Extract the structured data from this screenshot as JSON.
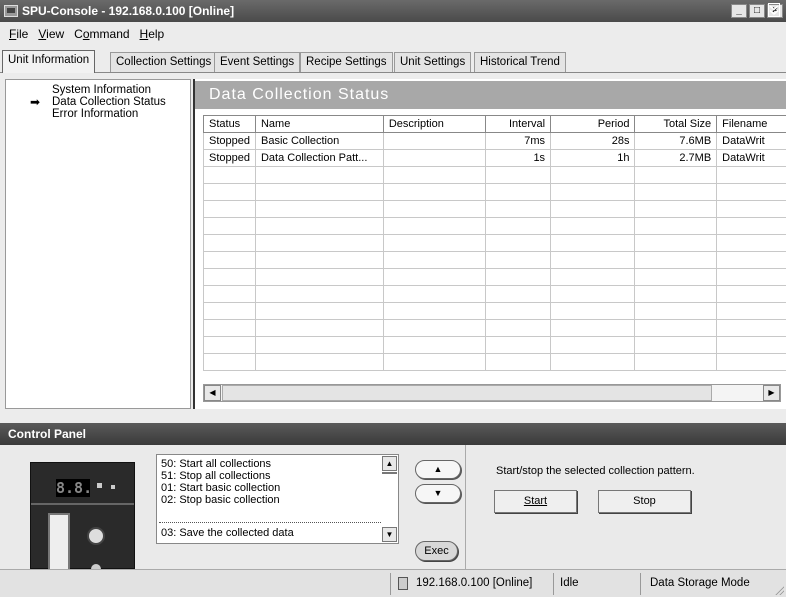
{
  "window": {
    "title": "SPU-Console - 192.168.0.100 [Online]",
    "minimize": "_",
    "maximize": "□",
    "close": "×"
  },
  "menu": [
    {
      "label": "File",
      "key": "F",
      "rest": "ile"
    },
    {
      "label": "View",
      "key": "V",
      "rest": "iew"
    },
    {
      "label": "Command",
      "pre": "C",
      "key": "o",
      "rest": "mmand"
    },
    {
      "label": "Help",
      "key": "H",
      "rest": "elp"
    }
  ],
  "tabs": [
    "Unit Information",
    "Collection Settings",
    "Event Settings",
    "Recipe Settings",
    "Unit Settings",
    "Historical Trend"
  ],
  "active_tab": "Unit Information",
  "tree": {
    "items": [
      "System Information",
      "Data Collection Status",
      "Error Information"
    ],
    "selected": "Data Collection Status",
    "arrow": "➡"
  },
  "content": {
    "header": "Data Collection Status",
    "columns": [
      "Status",
      "Name",
      "Description",
      "Interval",
      "Period",
      "Total Size",
      "Filename"
    ],
    "rows": [
      [
        "Stopped",
        "Basic Collection",
        "",
        "7ms",
        "28s",
        "7.6MB",
        "DataWrit"
      ],
      [
        "Stopped",
        "Data Collection Patt...",
        "",
        "1s",
        "1h",
        "2.7MB",
        "DataWrit"
      ]
    ],
    "scroll_left": "◀",
    "scroll_right": "▶"
  },
  "control_panel": {
    "title": "Control Panel",
    "collapse_icon": "¥",
    "device_led": "8.8.",
    "commands": [
      "50: Start all collections",
      "51: Stop all collections",
      "01: Start basic collection",
      "02: Stop basic collection",
      "03: Save the collected data"
    ],
    "up_arrow": "▲",
    "down_arrow": "▼",
    "exec_label": "Exec",
    "description": "Start/stop the selected collection pattern.",
    "start_label": "Start",
    "stop_label": "Stop"
  },
  "statusbar": {
    "connection": "192.168.0.100 [Online]",
    "state": "Idle",
    "mode": "Data Storage Mode"
  }
}
